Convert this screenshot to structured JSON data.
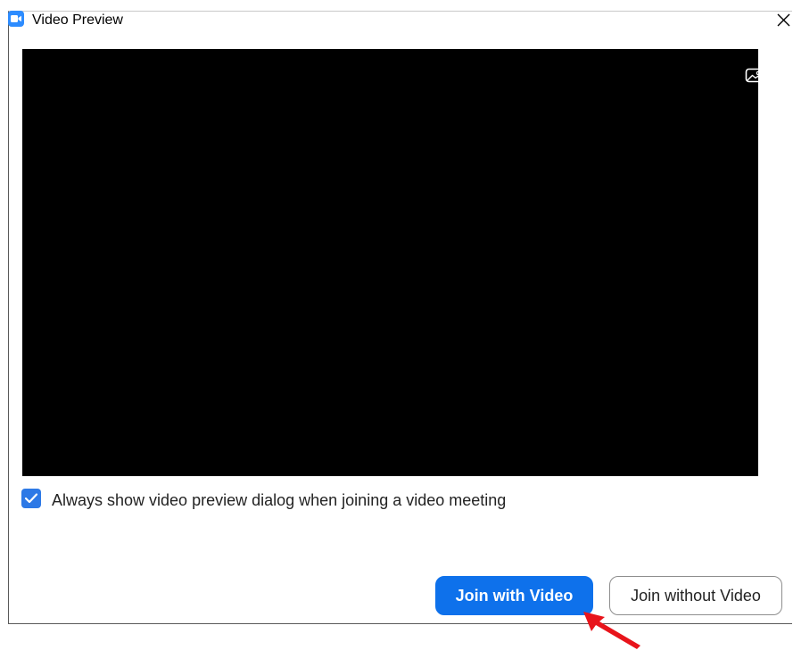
{
  "window": {
    "title": "Video Preview",
    "app_icon": "zoom-camera-icon",
    "close_icon": "close-icon"
  },
  "preview": {
    "background_icon": "virtual-background-icon"
  },
  "option": {
    "checked": true,
    "label": "Always show video preview dialog when joining a video meeting"
  },
  "buttons": {
    "join_with_video": "Join with Video",
    "join_without_video": "Join without Video"
  },
  "colors": {
    "accent": "#0e71eb",
    "checkbox": "#2d79e6",
    "annotation_arrow": "#e8141b"
  }
}
